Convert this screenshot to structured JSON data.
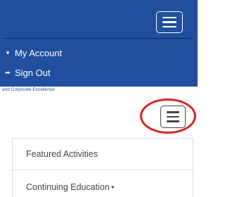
{
  "topnav": {
    "bg_color": "#1f4f9e",
    "menu_icon": "hamburger-icon",
    "items": [
      {
        "icon": "caret-down-icon",
        "icon_glyph": "▾",
        "label": "My Account"
      },
      {
        "icon": "sign-out-icon",
        "icon_glyph": "➦",
        "label": "Sign Out"
      }
    ]
  },
  "tagline": "and Corporate Excellence",
  "main": {
    "menu_icon": "hamburger-icon",
    "highlight_color": "#e02020",
    "menu_items": [
      {
        "label": "Featured Activities"
      },
      {
        "label": "Continuing Education",
        "caret": "▸"
      }
    ]
  }
}
